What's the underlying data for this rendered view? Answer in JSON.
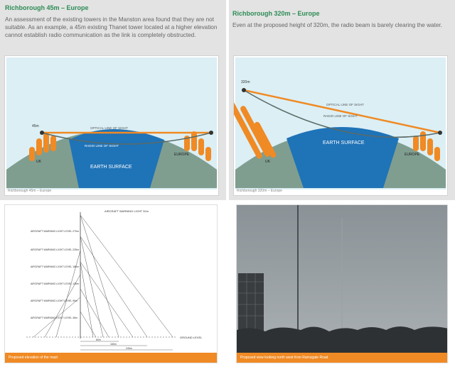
{
  "left_panel": {
    "title": "Richborough 45m – Europe",
    "description": "An assessment of the existing towers in the Manston area found that they are not suitable. As an example, a 45m existing Thanet tower located at a higher elevation cannot establish radio communication as the link is completely obstructed.",
    "diagram": {
      "tower_height_label": "45m",
      "optical_label": "OPTICAL LINE OF SIGHT",
      "radio_label": "RADIO LINE OF SIGHT",
      "earth_label": "EARTH SURFACE",
      "left_region": "UK",
      "right_region": "EUROPE",
      "caption": "Richborough 45m – Europe"
    }
  },
  "right_panel": {
    "title": "Richborough 320m – Europe",
    "description": "Even at the proposed height of 320m, the radio beam is barely clearing the water.",
    "diagram": {
      "tower_height_label": "320m",
      "optical_label": "OPTICAL LINE OF SIGHT",
      "radio_label": "RADIO LINE OF SIGHT",
      "earth_label": "EARTH SURFACE",
      "left_region": "UK",
      "right_region": "EUROPE",
      "caption": "Richborough 320m – Europe"
    }
  },
  "elevation_card": {
    "header": "AIRCRAFT WARNING LIGHT 32m",
    "levels": [
      "AIRCRAFT WARNING LIGHT LEVEL 270m",
      "AIRCRAFT WARNING LIGHT LEVEL 225m",
      "AIRCRAFT WARNING LIGHT LEVEL 180m",
      "AIRCRAFT WARNING LIGHT LEVEL 135m",
      "AIRCRAFT WARNING LIGHT LEVEL 90m",
      "AIRCRAFT WARNING LIGHT LEVEL 45m"
    ],
    "ground_label": "GROUND LEVEL",
    "dims": [
      "80m",
      "160m",
      "240m"
    ],
    "caption": "Proposed elevation of the mast"
  },
  "photo_card": {
    "caption": "Proposed view looking north west from Ramsgate Road"
  },
  "colors": {
    "accent_green": "#2e8b57",
    "orange": "#f08a24",
    "earth_blue": "#1f73b7",
    "land_grey": "#7f9e90",
    "sky": "#dbeff5"
  }
}
